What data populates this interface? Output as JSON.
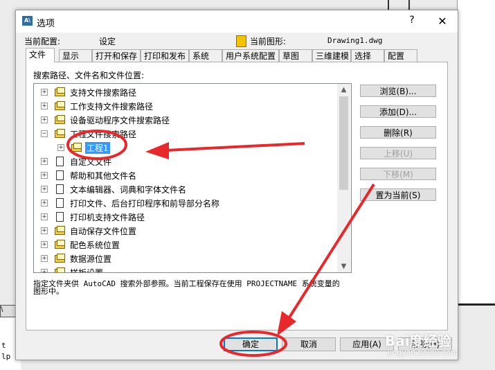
{
  "background": {
    "bottom_lines": [
      "t",
      "lp"
    ],
    "tab_marker": "\\"
  },
  "dialog": {
    "app_icon_text": "A\\",
    "title": "选项",
    "help_glyph": "?",
    "close_glyph": "✕",
    "current_profile_label": "当前配置:",
    "current_profile_value": "设定",
    "current_drawing_label": "当前图形:",
    "current_drawing_value": "Drawing1.dwg",
    "tabs": [
      "文件",
      "显示",
      "打开和保存",
      "打印和发布",
      "系统",
      "用户系统配置",
      "草图",
      "三维建模",
      "选择",
      "配置"
    ],
    "active_tab": "文件",
    "panel_heading": "搜索路径、文件名和文件位置:",
    "tree": [
      {
        "label": "支持文件搜索路径",
        "icon": "folder-stack-icon",
        "expander": "+"
      },
      {
        "label": "工作支持文件搜索路径",
        "icon": "folder-stack-icon",
        "expander": "+"
      },
      {
        "label": "设备驱动程序文件搜索路径",
        "icon": "folder-stack-icon",
        "expander": "+"
      },
      {
        "label": "工程文件搜索路径",
        "icon": "folder-stack-icon",
        "expander": "−"
      },
      {
        "label": "工程1",
        "icon": "folder-stack-icon",
        "expander": "+",
        "child": true,
        "selected": true
      },
      {
        "label": "自定义文件",
        "icon": "document-icon",
        "expander": "+"
      },
      {
        "label": "帮助和其他文件名",
        "icon": "document-icon",
        "expander": "+"
      },
      {
        "label": "文本编辑器、词典和字体文件名",
        "icon": "document-icon",
        "expander": "+"
      },
      {
        "label": "打印文件、后台打印程序和前导部分名称",
        "icon": "document-icon",
        "expander": "+"
      },
      {
        "label": "打印机支持文件路径",
        "icon": "document-icon",
        "expander": "+"
      },
      {
        "label": "自动保存文件位置",
        "icon": "folder-stack-icon",
        "expander": "+"
      },
      {
        "label": "配色系统位置",
        "icon": "folder-stack-icon",
        "expander": "+"
      },
      {
        "label": "数据源位置",
        "icon": "folder-stack-icon",
        "expander": "+"
      },
      {
        "label": "样板设置",
        "icon": "folder-stack-icon",
        "expander": "+"
      }
    ],
    "scroll_up_glyph": "▲",
    "scroll_down_glyph": "▼",
    "description": "指定文件夹供 AutoCAD 搜索外部参照。当前工程保存在使用 PROJECTNAME 系统变量的图形中。",
    "side_buttons": [
      {
        "label": "浏览(B)...",
        "enabled": true
      },
      {
        "label": "添加(D)...",
        "enabled": true
      },
      {
        "label": "删除(R)",
        "enabled": true
      },
      {
        "label": "上移(U)",
        "enabled": false
      },
      {
        "label": "下移(M)",
        "enabled": false
      },
      {
        "label": "置为当前(S)",
        "enabled": true
      }
    ],
    "bottom_buttons": {
      "ok": "确定",
      "cancel": "取消",
      "apply": "应用(A)",
      "help": "帮助(H)"
    }
  },
  "annotation": {
    "color": "#e8282b"
  },
  "watermark": {
    "main": "Bai度经验",
    "sub": "jingyan.baidu.com"
  }
}
